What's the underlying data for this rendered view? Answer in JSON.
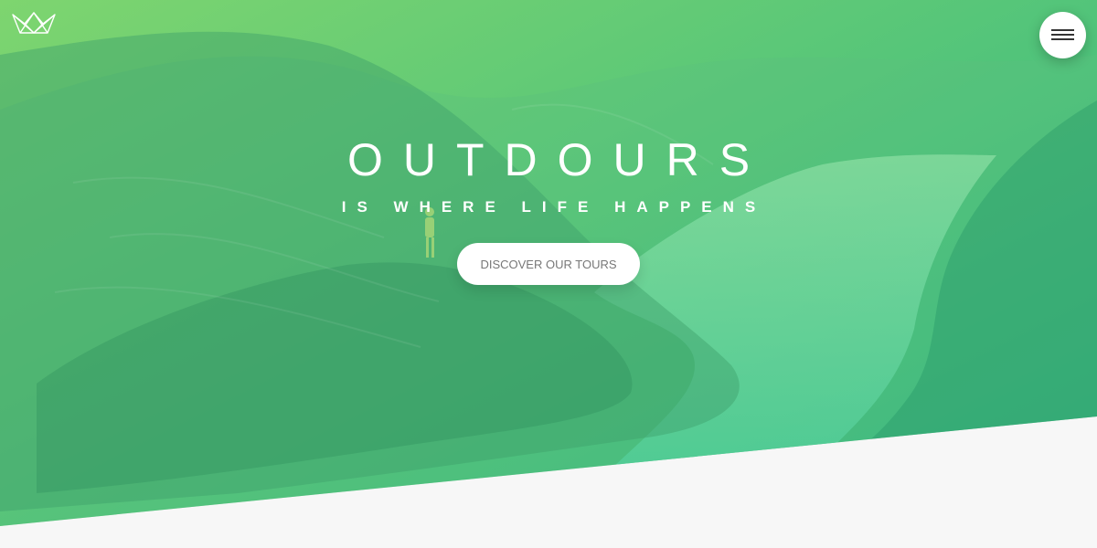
{
  "brand": {
    "logo_icon": "crown-logo-icon"
  },
  "header": {
    "menu_icon": "hamburger-menu-icon"
  },
  "hero": {
    "title": "OUTDOURS",
    "subtitle": "IS WHERE LIFE HAPPENS",
    "cta_label": "DISCOVER OUR TOURS"
  },
  "colors": {
    "gradient_start": "#7ed56f",
    "gradient_end": "#28b485",
    "section_background": "#f7f7f7",
    "text_on_hero": "#ffffff",
    "cta_text": "#777777"
  }
}
